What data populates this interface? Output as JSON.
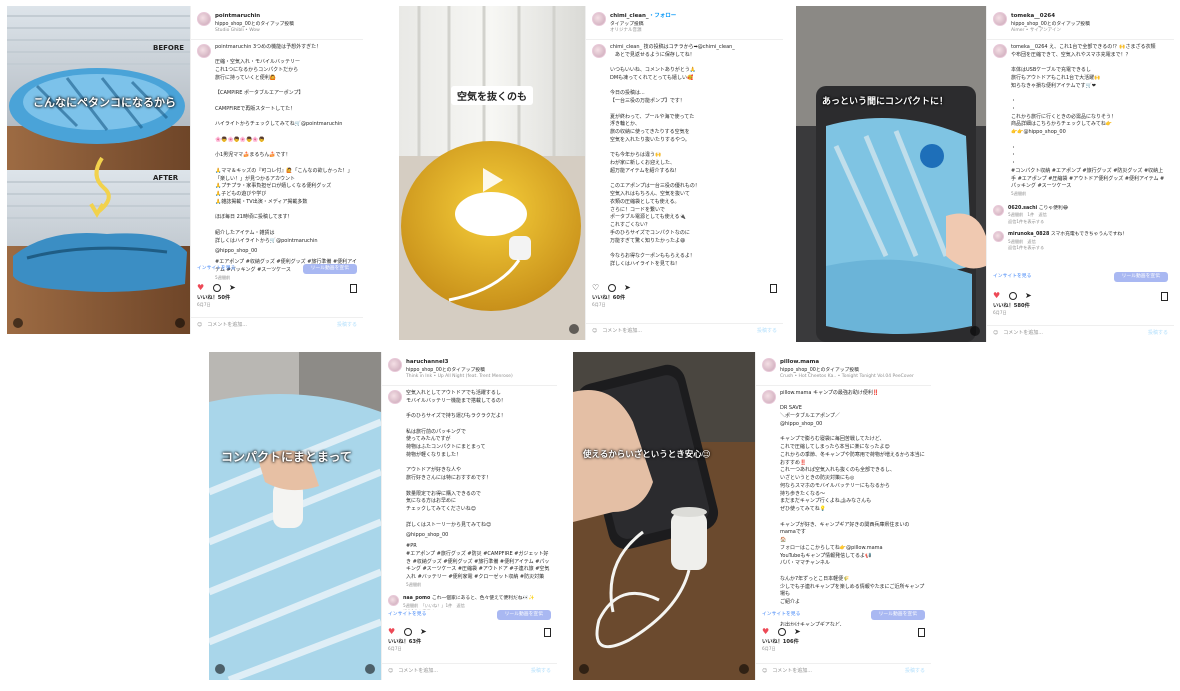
{
  "posts": [
    {
      "user": "pointmaruchin",
      "subtitle": "hippo_shop_00とのタイアップ投稿",
      "audio": "Studio Ghibli • Wow",
      "overlay": "こんなにペタンコになるから",
      "before_label": "BEFORE",
      "after_label": "AFTER",
      "caption": "pointmaruchin 3つめの機能は予想外すぎた！\n\n圧縮・空気入れ・モバイルバッテリー\nこれ1つになるからコンパクトだから\n旅行に持っていくと便利🙆\n\n【CAMPIRE ポータブルエアーポンプ】\n\nCAMPFIREで再販スタートしてた！\n\nハイライトからチェックしてみてね🛒@pointmaruchin\n\n🌸👦🌸👦🌸👦🌸👦\n\n小1男児ママ🍰まるちん🍰です！\n\n🙏ママ＆キッズの『可コレ付』🙋「こんなの欲しかった！」\n「楽しい！」が見つかるアカウント\n🙏プチプラ・家事負担ゼロが嬉しくなる便利グッズ\n🙏子どもの遊びや学び\n🙏雑誌掲載・TV出演・メディア掲載多数\n\nほぼ毎日 21時頃に投稿してます！\n\n紹介したアイテム・雑貨は\n詳しくはハイライトから🛒@pointmaruchin",
      "tag_user": "@hippo_shop_00",
      "hashtags": "#エアポンプ #収納グッズ #便利グッズ #旅行準備 #便利アイテム #パッキング #スーツケース",
      "time": "5週間前",
      "insight": "インサイトを見る",
      "reel_button": "リール動画を宣伝",
      "likes": "いいね！50件",
      "date": "6月7日",
      "add_comment": "コメントを追加...",
      "post_label": "投稿する"
    },
    {
      "user": "chimi_clean_",
      "follow": "・フォロー",
      "subtitle": "タイアップ投稿",
      "audio": "オリジナル音源",
      "overlay": "空気を抜くのも",
      "caption_user": "chimi_clean_",
      "caption": "chimi_clean_ 技の投稿はコチラから➡@chimi_clean_\n　あとで見返せるように保存してね！\n\nいつもいいね、コメントありがとう🙏\nDMも凍ってくれてとっても嬉しい🥰\n\n今日の投稿は...\n【一台三役の万能ポンプ】です！\n\n夏が終わって、プールや海で使ってた\n浮き輪とか、\n旅の収納に使ってきたりする空気を\n空気を入れたり抜いたりするやつ。\n\nでも今年からは違う🙌\nわが家に新しくお迎えした、\n超万能アイテムを紹介するね！\n\nこのエアポンプは一台三役の優れもの！\n空気入れはもちろん、空気を抜いて\n衣類の圧縮袋としても使える。\nさらに！コードを繋いで\nポータブル電源としても使える🔌\nこれすごくない？\n手のひらサイズでコンパクトなのに\n万能すぎて驚く知りたかったよ😆\n\n今ならお得なクーポンももらえるよ！\n詳しくはハイライトを見てね！",
      "likes": "いいね！60件",
      "date": "6月7日",
      "add_comment": "コメントを追加...",
      "post_label": "投稿する"
    },
    {
      "user": "tomeka__0264",
      "subtitle": "hippo_shop_00とのタイアップ投稿",
      "audio": "Aimer • サイアンアイン",
      "overlay": "あっという間にコンパクトに！",
      "caption": "tomeka__0264 え、これ1台で全部できるの!？🙌さまざる衣類\nや布団を圧縮できて、空気入れやスマホ充電まで！？\n\n本体はUSBケーブルで充電できるし\n旅行もアウトドアもこれ1台で大活躍🙌\n知らなきゃ損な便利アイテムです🛒❤\n\n・\n・\nこれから旅行に行くときの必需品になりそう！\n商品詳細はこちらからチェックしてみてね👉\n👉👉@hippo_shop_00\n\n・\n・\n・",
      "hashtags": "#コンパクト収納 #エアポンプ #旅行グッズ #防災グッズ #収納上手 #エアポンプ #圧縮袋 #アウトドア便利グッズ #便利アイテム #パッキング #スーツケース",
      "time": "5週間前",
      "comments": [
        {
          "user": "0620.sachi",
          "text": "こりゃ便利😂",
          "meta": "5週間前　1件　返信",
          "view": "返信1件を表示する"
        },
        {
          "user": "mirunoka_0828",
          "text": "スマホ充電もできちゃうんですね！",
          "meta": "5週間前　返信",
          "view": "返信1件を表示する"
        }
      ],
      "insight": "インサイトを見る",
      "reel_button": "リール動画を宣伝",
      "likes": "いいね！580件",
      "date": "6月7日",
      "add_comment": "コメントを追加...",
      "post_label": "投稿する"
    },
    {
      "user": "haruchannel3",
      "subtitle": "hippo_shop_00とのタイアップ投稿",
      "audio": "Think in Ink • Up All Night (feat. Trent Menrose)",
      "overlay": "コンパクトにまとまって",
      "caption": "空気入れとしてアウトドアでも活躍するし\nモバイルバッテリー機能まで搭載してるの！\n\n手のひらサイズで持ち運びもラクラクだよ！\n\n私は旅行前のパッキングで\n使ってみたんですが\n荷物はふたコンパクトにまとまって\n荷物が軽くなりました！\n\nアウトドアが好きな人や\n旅行好きさんには特におすすめです！\n\n数量限定でお得に購入できるので\n気になる方はお早めに\nチェックしてみてくださいね😊\n\n詳しくはストーリーから見てみてね😊",
      "tag_user": "@hippo_shop_00",
      "hashtags": "#PR\n#エアポンプ #旅行グッズ #防災 #CAMPFIRE #ガジェット好き #収納グッズ #便利グッズ #旅行準備 #便利アイテム #パッキング #スーツケース #圧縮袋 #アウトドア #子連れ旅 #空気入れ #バッテリー #便利家電 #クローゼット収納 #防災対策",
      "time": "5週間前",
      "comments": [
        {
          "user": "naa_pomo",
          "text": "これ一個家にあると、色々使えて便利だね👀✨",
          "meta": "5週間前　「いいね！」1件　返信",
          "view": "返信1件を表示する"
        }
      ],
      "insight": "インサイトを見る",
      "reel_button": "リール動画を宣伝",
      "likes": "いいね！63件",
      "date": "6月7日",
      "add_comment": "コメントを追加...",
      "post_label": "投稿する"
    },
    {
      "user": "pillow.mama",
      "subtitle": "hippo_shop_00とのタイアップ投稿",
      "audio": "Crush • Hot Cheetos Ka.. • Tonight Tonight Vol.04 PeeCover",
      "overlay": "使えるからいざというとき安心😉",
      "caption": "pillow.mama キャンプの最強お助け便利‼️\n\nDR SAVE\n＼ポータブルエアポンプ／\n@hippo_shop_00\n\nキャンプで膨らむ寝袋に毎回苦戦してたけど、\nこれで圧縮してしまったら本当に楽になったよ😊\nこれからの季節、冬キャンプや防寒用で荷物が増えるから本当に\nおすすめ‼️\nこれ一つあれば空気入れも抜くのも全部できるし、\nいざというときの防災対策にも◎\n何ならスマホのモバイルバッテリーにもなるから\n持ち歩きたくなる〜\nまだまだキャンプ行くよね🏕みなさんも\nぜひ使ってみてね💡\n\nキャンプが好き、キャンプギア好きの関西兵庫県住まいのmamaです\n🏠\nフォローはここからしてね👉@pillow.mama\nYouTubeもキャンプ情報発信してるよ📢\nパパ・ママチャンネル\n\nなんか7年ずっとこ日本軽便🌾\n少しでも子連れキャンプを楽しめる情報やたまにご近所キャンプ場も\nご紹介よ\n\nストーリーでは日常のお出掛けや、\nお出かけキャンプギアなど、\nタイムリーに発信です😍\n\nコメント、DMもぜひ待ってるです🙏",
      "insight": "インサイトを見る",
      "reel_button": "リール動画を宣伝",
      "likes": "いいね！106件",
      "date": "6月7日",
      "add_comment": "コメントを追加...",
      "post_label": "投稿する"
    }
  ]
}
